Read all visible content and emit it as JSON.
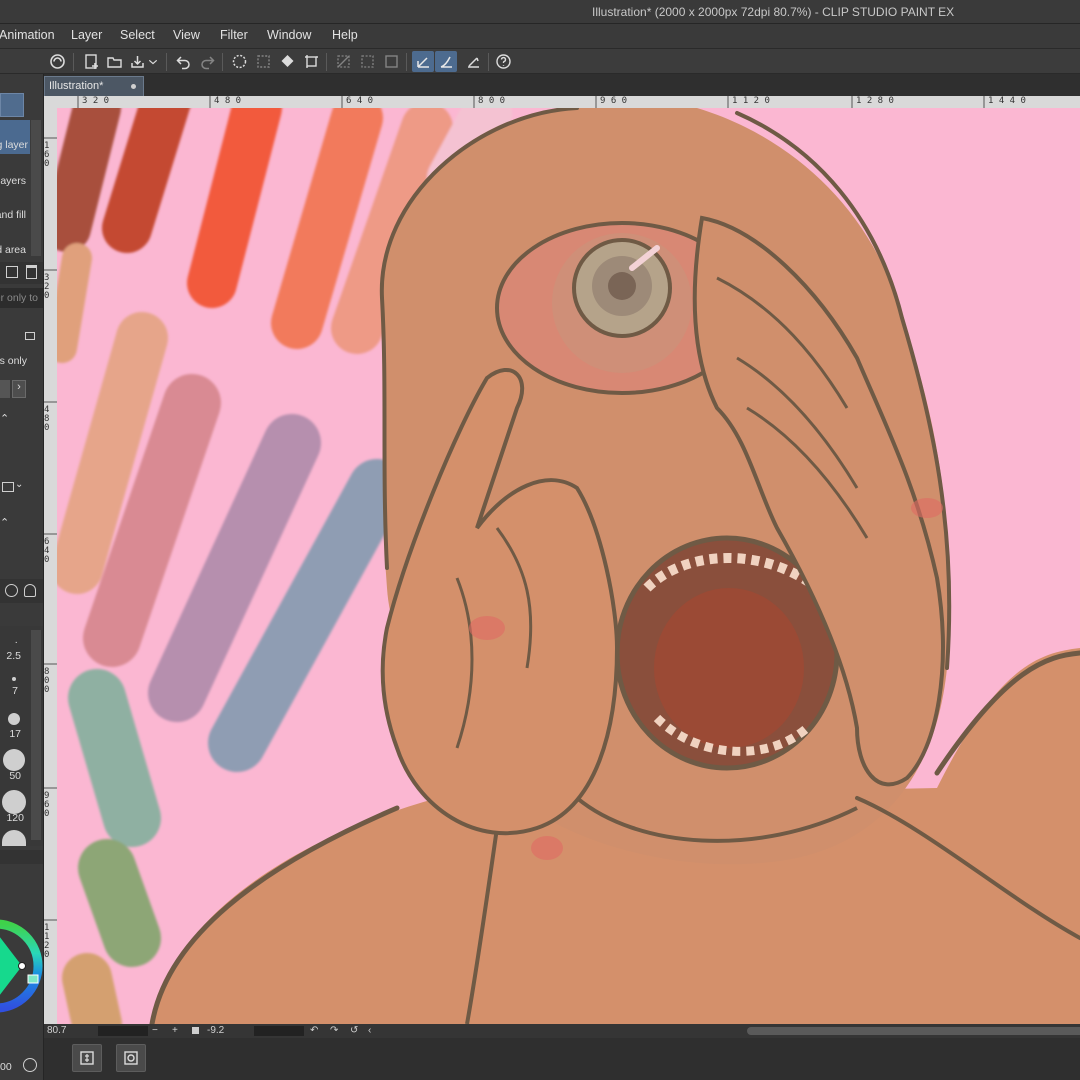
{
  "window": {
    "title": "Illustration* (2000 x 2000px 72dpi 80.7%)  - CLIP STUDIO PAINT EX"
  },
  "menu": {
    "items": [
      "Animation",
      "Layer",
      "Select",
      "View",
      "Filter",
      "Window",
      "Help"
    ]
  },
  "document_tab": {
    "label": "Illustration*"
  },
  "rulers": {
    "top": [
      "3 2 0",
      "4 8 0",
      "6 4 0",
      "8 0 0",
      "9 6 0",
      "1 1 2 0",
      "1 2 8 0",
      "1 4 4 0"
    ],
    "left": [
      "1 6 0",
      "3 2 0",
      "4 8 0",
      "6 4 0",
      "8 0 0",
      "9 6 0",
      "1 1 2 0"
    ]
  },
  "left_panel": {
    "layer_options": [
      "g layer",
      "layers",
      "and fill",
      "d area"
    ],
    "reference_placeholder": "er only to",
    "pixels_only": "els only",
    "brush_sizes": [
      "2.5",
      "7",
      "17",
      "50",
      "120"
    ],
    "footer_value": "00"
  },
  "status": {
    "zoom": "80.7",
    "angle": "-9.2"
  },
  "colors": {
    "canvas_background": "#fbb7d2",
    "ui_dark": "#3a3a3a",
    "active_tool": "#4d6b8f"
  },
  "icons": [
    "new-canvas-icon",
    "open-icon",
    "save-icon",
    "undo-icon",
    "redo-icon",
    "transform-icon",
    "fill-icon",
    "crop-icon",
    "stabilize-icon",
    "pen-pressure-icon",
    "help-icon"
  ]
}
